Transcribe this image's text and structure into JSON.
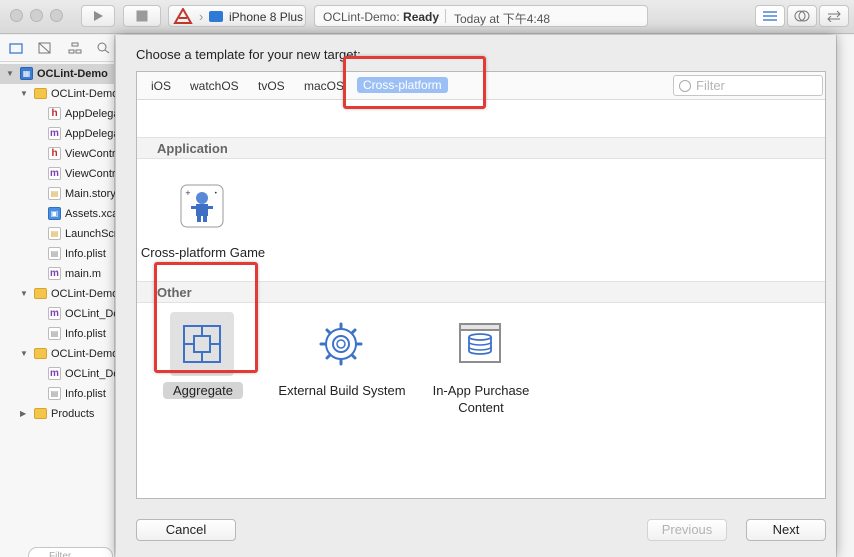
{
  "toolbar": {
    "device": "iPhone 8 Plus",
    "activity_project": "OCLint-Demo:",
    "activity_status": "Ready",
    "activity_time": "Today at 下午4:48"
  },
  "sidebar": {
    "items": [
      {
        "label": "OCLint-Demo",
        "icon": "project-icon"
      },
      {
        "label": "OCLint-Demo",
        "icon": "folder-icon"
      },
      {
        "label": "AppDelegate.h",
        "icon": "header-file-icon"
      },
      {
        "label": "AppDelegate.m",
        "icon": "source-file-icon"
      },
      {
        "label": "ViewController.h",
        "icon": "header-file-icon"
      },
      {
        "label": "ViewController.m",
        "icon": "source-file-icon"
      },
      {
        "label": "Main.storyboard",
        "icon": "storyboard-icon"
      },
      {
        "label": "Assets.xcassets",
        "icon": "asset-catalog-icon"
      },
      {
        "label": "LaunchScreen.storyboard",
        "icon": "storyboard-icon"
      },
      {
        "label": "Info.plist",
        "icon": "plist-icon"
      },
      {
        "label": "main.m",
        "icon": "source-file-icon"
      },
      {
        "label": "OCLint-DemoTests",
        "icon": "folder-icon"
      },
      {
        "label": "OCLint_DemoTests.m",
        "icon": "source-file-icon"
      },
      {
        "label": "Info.plist",
        "icon": "plist-icon"
      },
      {
        "label": "OCLint-DemoUITests",
        "icon": "folder-icon"
      },
      {
        "label": "OCLint_DemoUITests.m",
        "icon": "source-file-icon"
      },
      {
        "label": "Info.plist",
        "icon": "plist-icon"
      },
      {
        "label": "Products",
        "icon": "folder-icon"
      }
    ],
    "filter_placeholder": "Filter"
  },
  "sheet": {
    "title": "Choose a template for your new target:",
    "tabs": [
      "iOS",
      "watchOS",
      "tvOS",
      "macOS",
      "Cross-platform"
    ],
    "active_tab": "Cross-platform",
    "filter_placeholder": "Filter",
    "sections": [
      {
        "title": "Application",
        "templates": [
          {
            "name": "Cross-platform Game",
            "icon": "game-controller-icon"
          }
        ]
      },
      {
        "title": "Other",
        "templates": [
          {
            "name": "Aggregate",
            "icon": "aggregate-icon",
            "selected": true
          },
          {
            "name": "External Build System",
            "icon": "gear-icon"
          },
          {
            "name": "In-App Purchase Content",
            "icon": "database-icon"
          }
        ]
      }
    ],
    "buttons": {
      "cancel": "Cancel",
      "previous": "Previous",
      "next": "Next"
    }
  },
  "colors": {
    "highlight": "#e23b36",
    "tab_active": "#9cc0f5",
    "accent": "#3e7bd2"
  }
}
